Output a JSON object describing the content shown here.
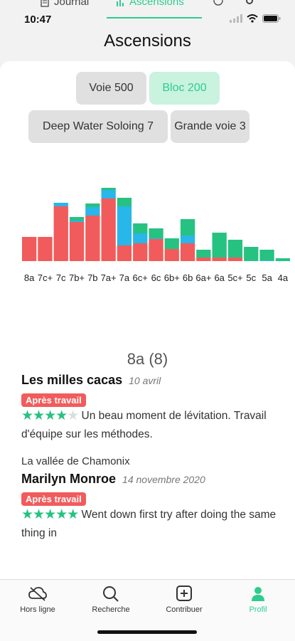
{
  "top_tabs": [
    {
      "label": "Journal",
      "icon": "journal-icon"
    },
    {
      "label": "Ascensions",
      "icon": "bar-chart-icon",
      "active": true
    }
  ],
  "status": {
    "time": "10:47"
  },
  "page_title": "Ascensions",
  "filters": [
    {
      "label": "Voie 500",
      "active": false
    },
    {
      "label": "Bloc 200",
      "active": true
    },
    {
      "label": "Deep Water Soloing 7",
      "active": false
    },
    {
      "label": "Grande voie 3",
      "active": false
    }
  ],
  "colors": {
    "red": "#f25b5b",
    "blue": "#29b6e8",
    "green": "#26c281",
    "accent": "#2ecc8f"
  },
  "chart_data": {
    "type": "bar",
    "stacked": true,
    "categories": [
      "8a",
      "7c+",
      "7c",
      "7b+",
      "7b",
      "7a+",
      "7a",
      "6c+",
      "6c",
      "6b+",
      "6b",
      "6a+",
      "6a",
      "5c+",
      "5c",
      "5a",
      "4a"
    ],
    "series": [
      {
        "color": "red",
        "values": [
          34,
          34,
          77,
          55,
          64,
          88,
          22,
          25,
          31,
          17,
          25,
          5,
          5,
          5,
          0,
          0,
          0
        ]
      },
      {
        "color": "blue",
        "values": [
          0,
          0,
          5,
          2,
          12,
          12,
          55,
          14,
          1,
          0,
          11,
          0,
          0,
          0,
          0,
          1,
          0
        ]
      },
      {
        "color": "green",
        "values": [
          0,
          0,
          0,
          5,
          5,
          3,
          12,
          14,
          14,
          15,
          23,
          11,
          35,
          25,
          20,
          15,
          4
        ]
      }
    ],
    "ylim": [
      0,
      160
    ]
  },
  "grade_section": {
    "grade": "8a",
    "count": "(8)"
  },
  "ascents": [
    {
      "route": "Les milles cacas",
      "date": "10 avril",
      "badge": "Après travail",
      "rating": 4,
      "comment": "Un beau moment de lévitation. Travail d'équipe sur les méthodes."
    },
    {
      "place": "La vallée de Chamonix",
      "route": "Marilyn Monroe",
      "date": "14 novembre 2020",
      "badge": "Après travail",
      "rating": 5,
      "comment": "Went down first try after doing the same thing in"
    }
  ],
  "bottom_nav": [
    {
      "label": "Hors ligne",
      "icon": "cloud-off-icon"
    },
    {
      "label": "Recherche",
      "icon": "search-icon"
    },
    {
      "label": "Contribuer",
      "icon": "plus-square-icon"
    },
    {
      "label": "Profil",
      "icon": "user-icon",
      "active": true
    }
  ]
}
